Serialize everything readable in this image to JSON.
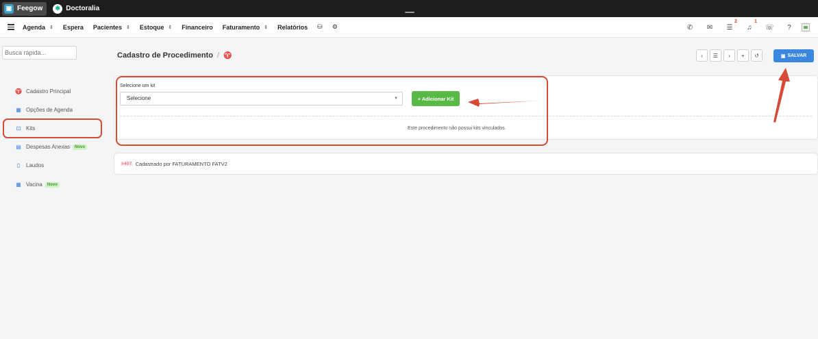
{
  "appbar": {
    "tabs": [
      {
        "label": "Feegow",
        "icon": "feegow-logo"
      },
      {
        "label": "Doctoralia",
        "icon": "doctoralia-logo"
      }
    ]
  },
  "navbar": {
    "items": [
      {
        "label": "Agenda",
        "dropdown": true
      },
      {
        "label": "Espera",
        "dropdown": false
      },
      {
        "label": "Pacientes",
        "dropdown": true
      },
      {
        "label": "Estoque",
        "dropdown": true
      },
      {
        "label": "Financeiro",
        "dropdown": false
      },
      {
        "label": "Faturamento",
        "dropdown": true
      },
      {
        "label": "Relatórios",
        "dropdown": false
      }
    ],
    "badges": {
      "tasks": "2",
      "notifications": "1"
    }
  },
  "sidebar": {
    "search_placeholder": "Busca rápida...",
    "items": [
      {
        "label": "Cadastro Principal",
        "icon": "stethoscope-icon"
      },
      {
        "label": "Opções de Agenda",
        "icon": "calendar-icon"
      },
      {
        "label": "Kits",
        "icon": "kit-box-icon"
      },
      {
        "label": "Despesas Anexas",
        "icon": "table-icon",
        "badge": "Novo"
      },
      {
        "label": "Laudos",
        "icon": "document-icon"
      },
      {
        "label": "Vacina",
        "icon": "calendar-icon",
        "badge": "Novo"
      }
    ]
  },
  "header": {
    "title": "Cadastro de Procedimento",
    "separator": "/",
    "save_label": "SALVAR"
  },
  "kit_form": {
    "label": "Selecione um kit",
    "select_value": "Selecione",
    "add_button": "+ Adicionar Kit",
    "empty_message": "Este procedimento não possui kits vinculados."
  },
  "registration": {
    "code": "#407",
    "text": "Cadastrado por FATURAMENTO FATV2"
  },
  "colors": {
    "primary": "#3b86de",
    "success": "#58b946",
    "annotation": "#d64a36"
  }
}
